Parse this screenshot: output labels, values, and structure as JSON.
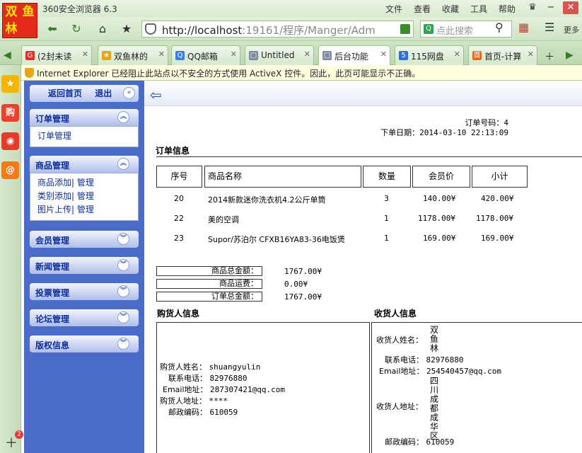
{
  "browser": {
    "logo_chars": [
      "双",
      "鱼",
      "林",
      ""
    ],
    "app_title": "360安全浏览器 6.3",
    "menus": [
      "文件",
      "查看",
      "收藏",
      "工具",
      "帮助"
    ],
    "url_host": "http://localhost",
    "url_rest": ":19161/程序/Manger/Adm",
    "search_placeholder": "点此搜索",
    "more_label": "更多",
    "tabs": [
      {
        "label": "(2封未读",
        "icon_text": "G",
        "color": "#d9302a"
      },
      {
        "label": "双鱼林的",
        "icon_text": "★",
        "color": "#e8a317"
      },
      {
        "label": "QQ邮箱",
        "icon_text": "Q",
        "color": "#3b7de0"
      },
      {
        "label": "Untitled",
        "icon_text": "□",
        "color": "#7a8a9a"
      },
      {
        "label": "后台功能",
        "icon_text": "□",
        "color": "#7a8a9a"
      },
      {
        "label": "115网盘",
        "icon_text": "5",
        "color": "#2d6fd6"
      },
      {
        "label": "首页-计算",
        "icon_text": "首",
        "color": "#e26a1f"
      }
    ],
    "infobar_text": "Internet Explorer 已经阻止此站点以不安全的方式使用 ActiveX 控件。因此，此页可能显示不正确。",
    "sidebar_badge": "2"
  },
  "admin_sidebar": {
    "home_label": "返回首页",
    "logout_label": "退出",
    "order_menu": {
      "title": "订单管理",
      "items": [
        "订单管理"
      ]
    },
    "goods_menu": {
      "title": "商品管理",
      "rows": [
        {
          "a": "商品添加",
          "b": "管理"
        },
        {
          "a": "类别添加",
          "b": "管理"
        },
        {
          "a": "图片上传",
          "b": "管理"
        }
      ]
    },
    "collapsed_menus": [
      "会员管理",
      "新闻管理",
      "投票管理",
      "论坛管理",
      "版权信息"
    ]
  },
  "order": {
    "order_no_label": "订单号码：",
    "order_no": "4",
    "order_date_label": "下单日期：",
    "order_date": "2014-03-10 22:13:09",
    "info_title": "订单信息",
    "columns": [
      "序号",
      "商品名称",
      "数量",
      "会员价",
      "小计"
    ],
    "items": [
      {
        "id": "20",
        "name": "2014新款迷你洗衣机4.2公斤单筒",
        "qty": "3",
        "price": "140.00¥",
        "subtotal": "420.00¥"
      },
      {
        "id": "22",
        "name": "美的空调",
        "qty": "1",
        "price": "1178.00¥",
        "subtotal": "1178.00¥"
      },
      {
        "id": "23",
        "name": "Supor/苏泊尔 CFXB16YA83-36电饭煲",
        "qty": "1",
        "price": "169.00¥",
        "subtotal": "169.00¥"
      }
    ],
    "summary": [
      {
        "label": "商品总金额：",
        "value": "1767.00¥"
      },
      {
        "label": "商品运费：",
        "value": "0.00¥"
      },
      {
        "label": "订单总金额：",
        "value": "1767.00¥"
      }
    ],
    "buyer": {
      "title": "购货人信息",
      "name_label": "购货人姓名：",
      "name": "shuangyulin",
      "phone_label": "联系电话：",
      "phone": "82976880",
      "email_label": "Email地址：",
      "email": "287307421@qq.com",
      "address_label": "购货人地址：",
      "address": "****",
      "zip_label": "邮政编码：",
      "zip": "610059"
    },
    "receiver": {
      "title": "收货人信息",
      "name_label": "收货人姓名：",
      "name": "双鱼林",
      "phone_label": "联系电话：",
      "phone": "82976880",
      "email_label": "Email地址：",
      "email": "254540457@qq.com",
      "address_label": "收货人地址：",
      "address": "四川成都成华区",
      "zip_label": "邮政编码：",
      "zip": "610059"
    }
  }
}
